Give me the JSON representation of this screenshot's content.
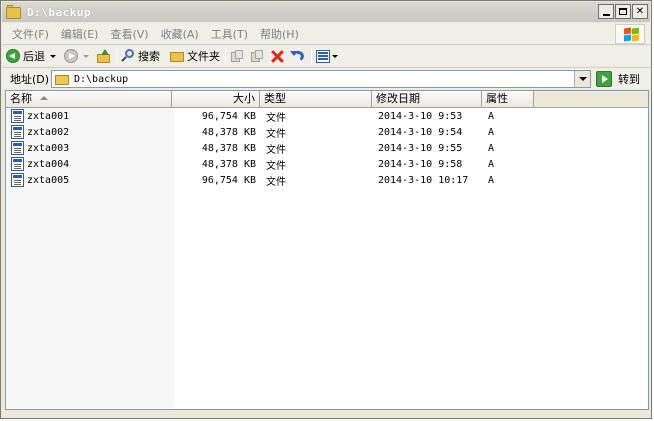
{
  "window": {
    "title": "D:\\backup"
  },
  "menu": {
    "items": [
      "文件(F)",
      "编辑(E)",
      "查看(V)",
      "收藏(A)",
      "工具(T)",
      "帮助(H)"
    ]
  },
  "toolbar": {
    "back_label": "后退",
    "search_label": "搜索",
    "folders_label": "文件夹"
  },
  "address": {
    "label": "地址(D)",
    "value": "D:\\backup",
    "go_label": "转到"
  },
  "columns": {
    "name": "名称",
    "size": "大小",
    "type": "类型",
    "modified": "修改日期",
    "attributes": "属性"
  },
  "files": [
    {
      "name": "zxta001",
      "size": "96,754 KB",
      "type": "文件",
      "modified": "2014-3-10 9:53",
      "attributes": "A"
    },
    {
      "name": "zxta002",
      "size": "48,378 KB",
      "type": "文件",
      "modified": "2014-3-10 9:54",
      "attributes": "A"
    },
    {
      "name": "zxta003",
      "size": "48,378 KB",
      "type": "文件",
      "modified": "2014-3-10 9:55",
      "attributes": "A"
    },
    {
      "name": "zxta004",
      "size": "48,378 KB",
      "type": "文件",
      "modified": "2014-3-10 9:58",
      "attributes": "A"
    },
    {
      "name": "zxta005",
      "size": "96,754 KB",
      "type": "文件",
      "modified": "2014-3-10 10:17",
      "attributes": "A"
    }
  ],
  "colors": {
    "window_bg": "#ece9d8",
    "accent": "#2c5fb0",
    "delete": "#e0281c",
    "go_green": "#3ea33e"
  }
}
